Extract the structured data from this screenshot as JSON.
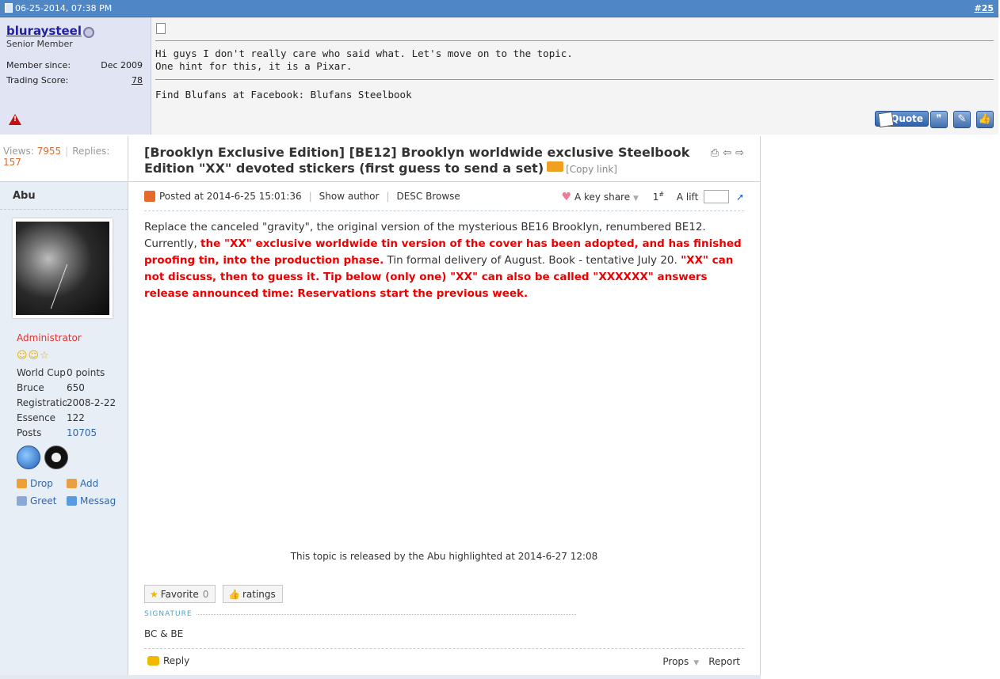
{
  "top_post": {
    "datetime": "06-25-2014, 07:38 PM",
    "post_number_prefix": "#",
    "post_number": "25",
    "user": {
      "name": "bluraysteel",
      "title": "Senior Member",
      "member_since_label": "Member since:",
      "member_since": "Dec 2009",
      "trading_score_label": "Trading Score:",
      "trading_score": "78"
    },
    "message": {
      "line1": "Hi guys I don't really care who said what. Let's move on to the topic.",
      "line2": "One hint for this, it is a Pixar.",
      "signature": "Find Blufans at Facebook: Blufans Steelbook"
    },
    "buttons": {
      "quote": "Quote"
    }
  },
  "thread": {
    "views_label": "Views:",
    "views": "7955",
    "replies_label": "Replies:",
    "replies": "157",
    "title": "[Brooklyn Exclusive Edition] [BE12] Brooklyn worldwide exclusive Steelbook Edition \"XX\" devoted stickers (first guess to send a set)",
    "copy_link": "[Copy link]",
    "icons": [
      "print-icon",
      "prev-thread-icon",
      "next-thread-icon"
    ]
  },
  "author_panel": {
    "name": "Abu",
    "role": "Administrator",
    "rank_icons": "☺☺☆",
    "stats": [
      {
        "label": "World Cup",
        "value": "0 points"
      },
      {
        "label": "Bruce",
        "value": "650"
      },
      {
        "label": "Registration",
        "value": "2008-2-22"
      },
      {
        "label": "Essence",
        "value": "122"
      },
      {
        "label": "Posts",
        "value": "10705"
      }
    ],
    "actions": {
      "drop": "Drop",
      "add": "Add",
      "greet": "Greet",
      "message": "Messag"
    }
  },
  "post": {
    "posted_at": "Posted at 2014-6-25 15:01:36",
    "show_author": "Show author",
    "desc_browse": "DESC Browse",
    "key_share": "A key share",
    "floor": "1",
    "floor_suffix": "#",
    "lift_label": "A lift",
    "body_part1": "Replace the canceled \"gravity\", the original version of the mysterious BE16 Brooklyn, renumbered BE12. Currently, ",
    "body_red1": "the \"XX\" exclusive worldwide tin version of the cover has been adopted, and has finished proofing tin, into the production phase.",
    "body_part2": " Tin formal delivery of August. Book - tentative July 20. ",
    "body_red2": "\"XX\" can not discuss, then to guess it. Tip below (only one) \"XX\" can also be called \"XXXXXX\" answers release announced time: Reservations start the previous week.",
    "highlight_note": "This topic is released by the Abu highlighted at 2014-6-27 12:08",
    "favorite_label": "Favorite",
    "favorite_count": "0",
    "ratings_label": "ratings",
    "signature_label": "SIGNATURE",
    "signature": "BC & BE",
    "reply_label": "Reply",
    "props_label": "Props",
    "report_label": "Report"
  },
  "colors": {
    "topbar": "#4f86c6",
    "user_panel": "#e1e4f2",
    "highlight_red": "#ee0000",
    "role_red": "#e03030",
    "views_orange": "#e06a29"
  }
}
